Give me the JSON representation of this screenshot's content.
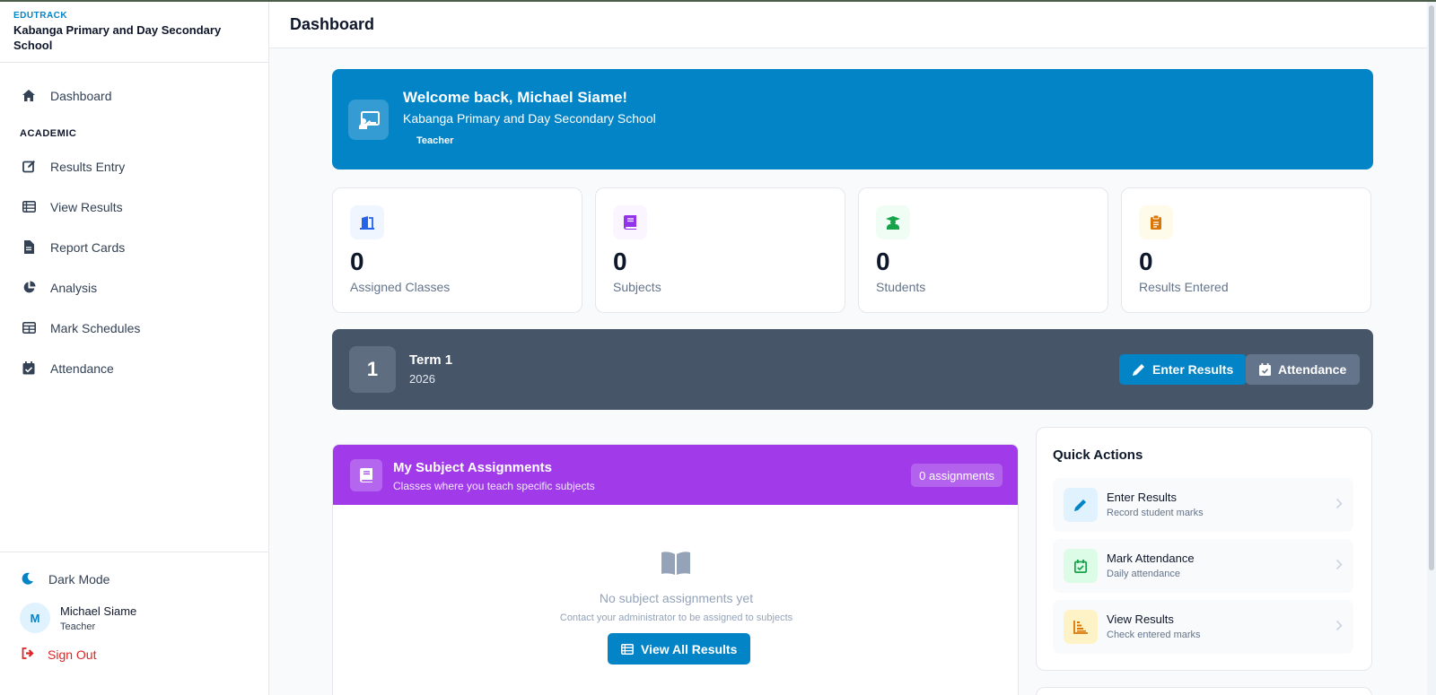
{
  "brand": {
    "tag": "EDUTRACK",
    "school": "Kabanga Primary and Day Secondary School"
  },
  "sidebar": {
    "dashboard": "Dashboard",
    "section_academic": "ACADEMIC",
    "items": [
      {
        "label": "Results Entry",
        "icon": "edit-icon"
      },
      {
        "label": "View Results",
        "icon": "table-icon"
      },
      {
        "label": "Report Cards",
        "icon": "file-icon"
      },
      {
        "label": "Analysis",
        "icon": "pie-chart-icon"
      },
      {
        "label": "Mark Schedules",
        "icon": "grid-icon"
      },
      {
        "label": "Attendance",
        "icon": "calendar-check-icon"
      }
    ],
    "dark_mode": "Dark Mode",
    "user": {
      "initial": "M",
      "name": "Michael Siame",
      "role": "Teacher"
    },
    "sign_out": "Sign Out"
  },
  "header": {
    "title": "Dashboard"
  },
  "welcome": {
    "title": "Welcome back, Michael Siame!",
    "school": "Kabanga Primary and Day Secondary School",
    "role": "Teacher"
  },
  "stats": [
    {
      "value": "0",
      "label": "Assigned Classes",
      "color": "#2563eb",
      "bg": "#eff6ff"
    },
    {
      "value": "0",
      "label": "Subjects",
      "color": "#9333ea",
      "bg": "#faf5ff"
    },
    {
      "value": "0",
      "label": "Students",
      "color": "#16a34a",
      "bg": "#f0fdf4"
    },
    {
      "value": "0",
      "label": "Results Entered",
      "color": "#d97706",
      "bg": "#fffbeb"
    }
  ],
  "term": {
    "number": "1",
    "name": "Term 1",
    "year": "2026",
    "enter_results": "Enter Results",
    "attendance": "Attendance"
  },
  "assignments": {
    "title": "My Subject Assignments",
    "subtitle": "Classes where you teach specific subjects",
    "badge": "0 assignments",
    "empty_title": "No subject assignments yet",
    "empty_sub": "Contact your administrator to be assigned to subjects",
    "button": "View All Results"
  },
  "quick_actions": {
    "title": "Quick Actions",
    "items": [
      {
        "title": "Enter Results",
        "sub": "Record student marks",
        "color": "#0284c7",
        "bg": "#e0f2fe"
      },
      {
        "title": "Mark Attendance",
        "sub": "Daily attendance",
        "color": "#16a34a",
        "bg": "#dcfce7"
      },
      {
        "title": "View Results",
        "sub": "Check entered marks",
        "color": "#d97706",
        "bg": "#fef3c7"
      }
    ]
  },
  "colors": {
    "accent": "#0284c7",
    "purple": "#a13bea",
    "slate": "#475569",
    "danger": "#dc2626"
  }
}
